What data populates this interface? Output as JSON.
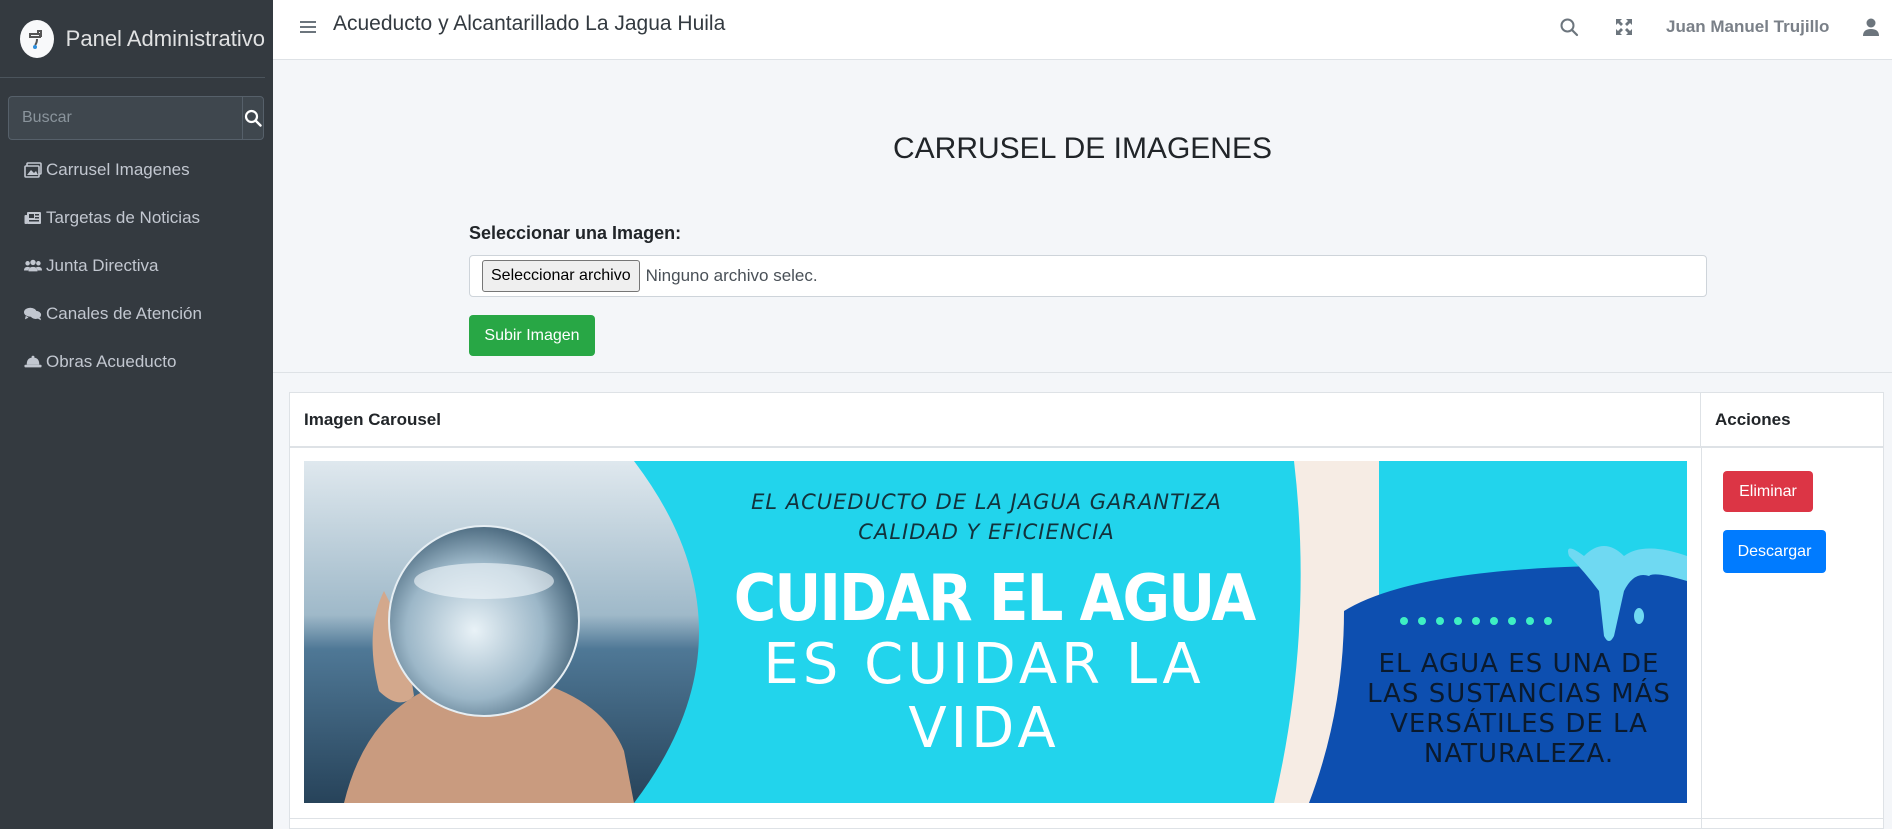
{
  "sidebar": {
    "brand": "Panel Administrativo",
    "search_placeholder": "Buscar",
    "items": [
      {
        "label": "Carrusel Imagenes",
        "icon": "images-icon"
      },
      {
        "label": "Targetas de Noticias",
        "icon": "newspaper-icon"
      },
      {
        "label": "Junta Directiva",
        "icon": "users-icon"
      },
      {
        "label": "Canales de Atención",
        "icon": "comments-icon"
      },
      {
        "label": "Obras Acueducto",
        "icon": "hard-hat-icon"
      }
    ]
  },
  "header": {
    "title": "Acueducto y Alcantarillado La Jagua Huila",
    "user": "Juan Manuel Trujillo",
    "icons": [
      "bars-icon",
      "search-icon",
      "expand-icon",
      "user-icon"
    ]
  },
  "main": {
    "page_title": "CARRUSEL DE IMAGENES",
    "upload": {
      "label": "Seleccionar una Imagen:",
      "file_button": "Seleccionar archivo",
      "file_status": "Ninguno archivo selec.",
      "submit": "Subir Imagen"
    },
    "table": {
      "headers": [
        "Imagen Carousel",
        "Acciones"
      ],
      "rows": [
        {
          "banner": {
            "tagline": "EL ACUEDUCTO DE LA JAGUA GARANTIZA CALIDAD Y EFICIENCIA",
            "headline": "CUIDAR EL AGUA",
            "subline": "ES CUIDAR LA VIDA",
            "side_text": "EL AGUA ES UNA DE LAS SUSTANCIAS MÁS VERSÁTILES DE LA NATURALEZA."
          },
          "actions": {
            "delete": "Eliminar",
            "download": "Descargar"
          }
        }
      ]
    }
  },
  "colors": {
    "sidebar_bg": "#343a40",
    "success": "#28a745",
    "danger": "#dc3545",
    "primary": "#007bff",
    "banner_cyan": "#22d4ec",
    "banner_blue": "#0d4fb0"
  }
}
